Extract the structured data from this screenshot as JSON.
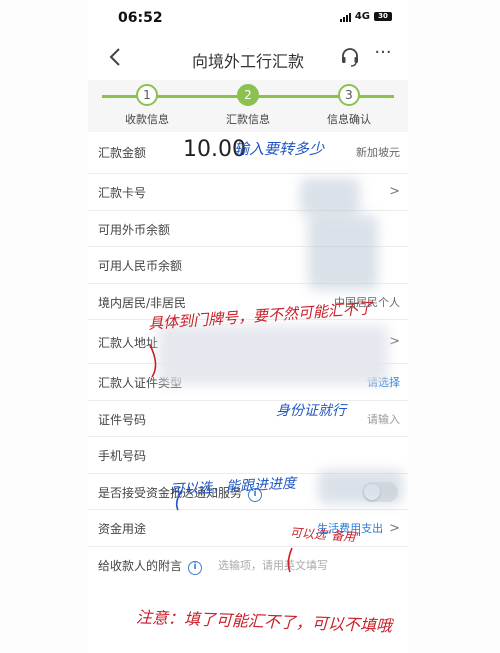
{
  "status": {
    "time": "06:52",
    "network": "4G",
    "battery": "30"
  },
  "nav": {
    "title": "向境外工行汇款"
  },
  "steps": [
    {
      "number": "1",
      "label": "收款信息"
    },
    {
      "number": "2",
      "label": "汇款信息"
    },
    {
      "number": "3",
      "label": "信息确认"
    }
  ],
  "form": {
    "amount": {
      "label": "汇款金额",
      "value": "10.00",
      "currency": "新加坡元"
    },
    "card": {
      "label": "汇款卡号"
    },
    "fx_balance": {
      "label": "可用外币余额"
    },
    "rmb_balance": {
      "label": "可用人民币余额"
    },
    "residency": {
      "label": "境内居民/非居民",
      "value": "中国居民个人"
    },
    "address": {
      "label": "汇款人地址"
    },
    "id_type": {
      "label": "汇款人证件类型",
      "value": "请选择"
    },
    "id_number": {
      "label": "证件号码",
      "placeholder": "请输入"
    },
    "phone": {
      "label": "手机号码"
    },
    "notify": {
      "label": "是否接受资金抵达通知服务"
    },
    "purpose": {
      "label": "资金用途",
      "value": "生活费用支出"
    },
    "remark": {
      "label": "给收款人的附言",
      "placeholder": "选输项，请用英文填写"
    }
  },
  "annotations": {
    "amount_note": "输入要转多少",
    "address_note": "具体到门牌号，要不然可能汇不了",
    "id_note": "身份证就行",
    "phone_note": "可以选，能跟进进度",
    "notify_note": "可以选\"备用\"",
    "remark_note": "注意：填了可能汇不了，可以不填哦"
  },
  "colors": {
    "accent_green": "#8cc152",
    "link_blue": "#2a7bd6",
    "annotation_blue": "#2157c4",
    "annotation_red": "#c8202a"
  }
}
